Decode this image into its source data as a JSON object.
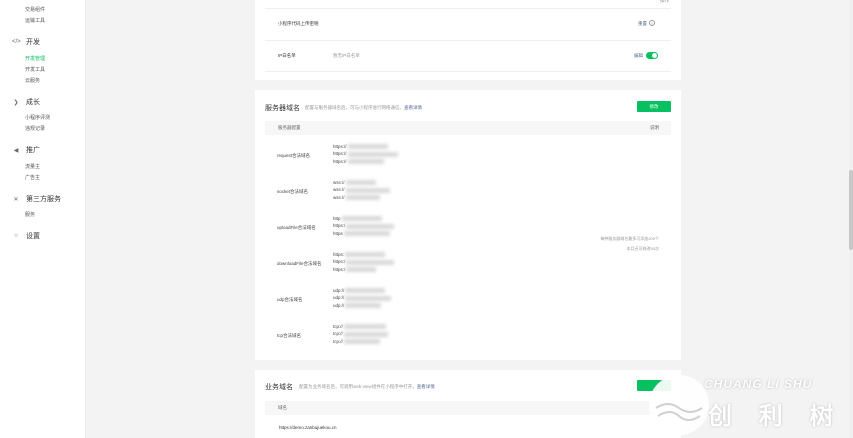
{
  "sidebar": {
    "items_top": [
      "交易组件",
      "运输工具"
    ],
    "dev": {
      "title": "开发",
      "items": [
        "开发管理",
        "开发工具",
        "云服务"
      ]
    },
    "growth": {
      "title": "成长",
      "items": [
        "小程序评测",
        "违规记录"
      ]
    },
    "promote": {
      "title": "推广",
      "items": [
        "流量主",
        "广告主"
      ]
    },
    "third": {
      "title": "第三方服务",
      "items": [
        "服务"
      ]
    },
    "settings": {
      "title": "设置"
    }
  },
  "top_card": {
    "header_action": "操作",
    "row1_label": "小程序代码上传密钥",
    "row1_action": "重置",
    "row2_label": "IP白名单",
    "row2_desc": "暂无IP白名单",
    "row2_action": "编辑"
  },
  "server_domain": {
    "title": "服务器域名",
    "desc": "配置与服务器域名后，可与小程序进行网络通信。",
    "desc_link": "查看详情",
    "button": "修改",
    "col1": "服务器配置",
    "col2": "说明",
    "rows": [
      {
        "name": "request合法域名",
        "urls": [
          "https://",
          "https://",
          "https://"
        ]
      },
      {
        "name": "socket合法域名",
        "urls": [
          "wss://",
          "wss://",
          "wss://"
        ]
      },
      {
        "name": "uploadFile合法域名",
        "urls": [
          "http",
          "https:/",
          "https"
        ]
      },
      {
        "name": "downloadFile合法域名",
        "urls": [
          "https:",
          "https:/",
          "https:/"
        ]
      },
      {
        "name": "udp合法域名",
        "urls": [
          "udp://",
          "udp://",
          "udp://"
        ]
      },
      {
        "name": "tcp合法域名",
        "urls": [
          "tcp://",
          "tcp://",
          "tcp://"
        ]
      }
    ],
    "note_line1": "每种服务器域名最多可添加200个",
    "note_line2": "本月还可修改50次"
  },
  "business_domain": {
    "title": "业务域名",
    "desc": "配置为业务域名后，可调用web-view组件在小程序中打开。",
    "desc_link": "查看详情",
    "col1": "域名",
    "row1": "https://demo.zanbujuekou.cn"
  },
  "watermark": {
    "latin": "CHUANG LI SHU",
    "cn": "创 利 树"
  },
  "colors": {
    "accent": "#07c160",
    "link": "#576b95"
  }
}
